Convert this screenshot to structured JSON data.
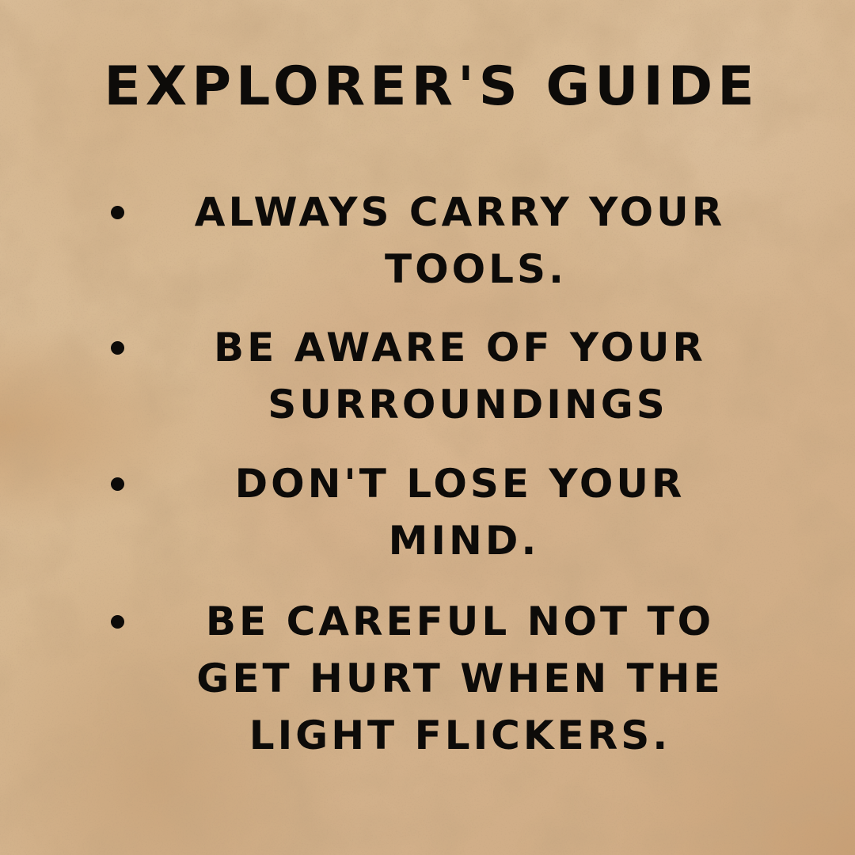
{
  "title": "EXPLORER'S GUIDE",
  "items": [
    {
      "lines": [
        "ALWAYS CARRY YOUR",
        "TOOLS."
      ]
    },
    {
      "lines": [
        "BE AWARE OF YOUR",
        "SURROUNDINGS"
      ]
    },
    {
      "lines": [
        "DON'T LOSE YOUR",
        "MIND."
      ]
    },
    {
      "lines": [
        "BE CAREFUL NOT TO",
        "GET HURT WHEN THE",
        "LIGHT FLICKERS."
      ]
    }
  ],
  "colors": {
    "background": "#d6b790",
    "text": "#0d0b09"
  }
}
